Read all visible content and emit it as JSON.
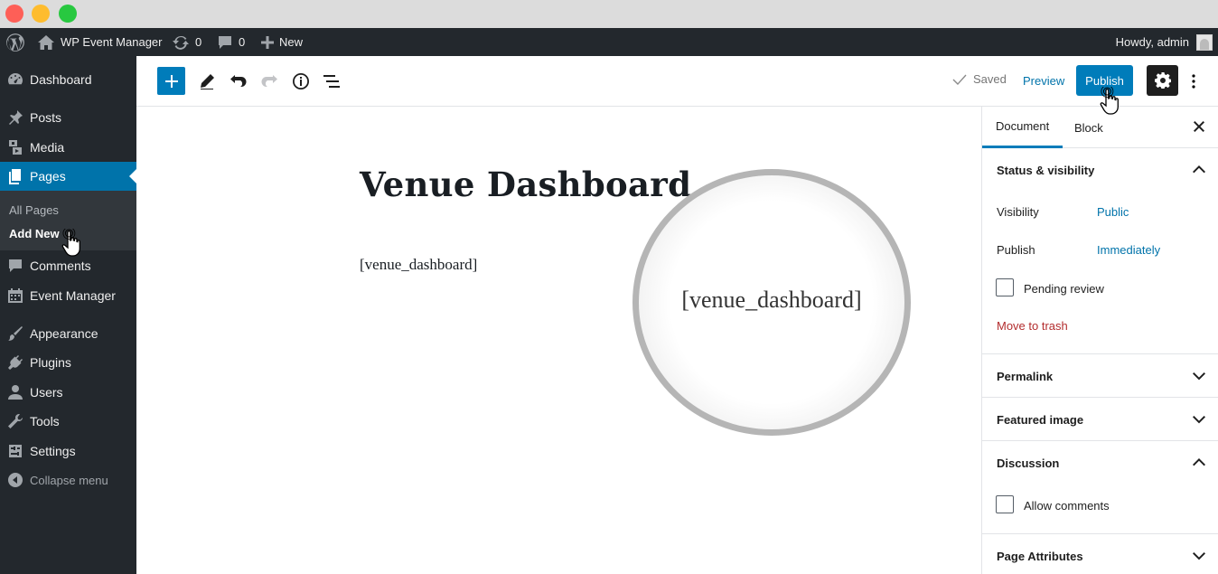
{
  "adminbar": {
    "site_name": "WP Event Manager",
    "updates_count": "0",
    "comments_count": "0",
    "new_label": "New",
    "howdy": "Howdy, admin"
  },
  "menu": {
    "dashboard": "Dashboard",
    "posts": "Posts",
    "media": "Media",
    "pages": "Pages",
    "all_pages": "All Pages",
    "add_new": "Add New",
    "comments": "Comments",
    "event_manager": "Event Manager",
    "appearance": "Appearance",
    "plugins": "Plugins",
    "users": "Users",
    "tools": "Tools",
    "settings": "Settings",
    "collapse": "Collapse menu"
  },
  "toolbar": {
    "saved": "Saved",
    "preview": "Preview",
    "publish": "Publish"
  },
  "editor": {
    "title": "Venue Dashboard",
    "shortcode": "[venue_dashboard]",
    "magnified_text": "[venue_dashboard]"
  },
  "sidebar": {
    "tab_document": "Document",
    "tab_block": "Block",
    "status_visibility": "Status & visibility",
    "visibility_label": "Visibility",
    "visibility_value": "Public",
    "publish_label": "Publish",
    "publish_value": "Immediately",
    "pending_review": "Pending review",
    "move_to_trash": "Move to trash",
    "permalink": "Permalink",
    "featured_image": "Featured image",
    "discussion": "Discussion",
    "allow_comments": "Allow comments",
    "page_attributes": "Page Attributes"
  },
  "colors": {
    "accent": "#007cba",
    "admin_bg": "#23282d",
    "menu_current": "#0073aa",
    "trash": "#b32d2e"
  }
}
